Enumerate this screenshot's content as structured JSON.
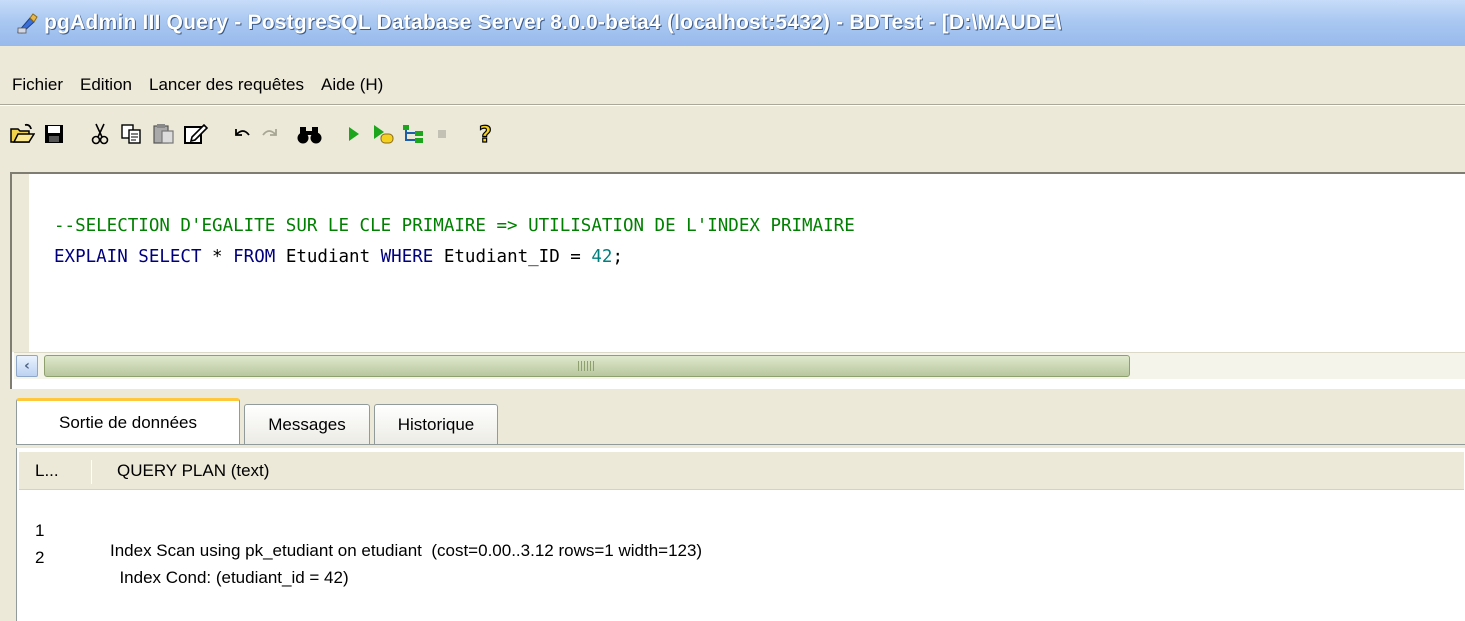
{
  "window": {
    "title": "pgAdmin III Query - PostgreSQL Database Server 8.0.0-beta4 (localhost:5432) - BDTest - [D:\\MAUDE\\"
  },
  "menu": {
    "items": [
      "Fichier",
      "Edition",
      "Lancer des requêtes",
      "Aide (H)"
    ]
  },
  "toolbar": {
    "buttons": [
      "open-icon",
      "save-icon",
      "cut-icon",
      "copy-icon",
      "paste-icon",
      "edit-icon",
      "undo-icon",
      "redo-icon",
      "find-icon",
      "execute-icon",
      "execute-to-file-icon",
      "explain-icon",
      "stop-icon",
      "help-icon"
    ]
  },
  "editor": {
    "line1": "--SELECTION D'EGALITE SUR LE CLE PRIMAIRE => UTILISATION DE L'INDEX PRIMAIRE",
    "line2": {
      "kw1": "EXPLAIN SELECT",
      "star": " * ",
      "kw2": "FROM",
      "table": " Etudiant ",
      "kw3": "WHERE",
      "cond": " Etudiant_ID = ",
      "num": "42",
      "end": ";"
    }
  },
  "tabs": [
    "Sortie de données",
    "Messages",
    "Historique"
  ],
  "grid": {
    "columns": [
      "L...",
      "QUERY PLAN (text)"
    ],
    "rows": [
      {
        "n": "1",
        "text": "Index Scan using pk_etudiant on etudiant  (cost=0.00..3.12 rows=1 width=123)"
      },
      {
        "n": "2",
        "text": "  Index Cond: (etudiant_id = 42)"
      }
    ]
  }
}
